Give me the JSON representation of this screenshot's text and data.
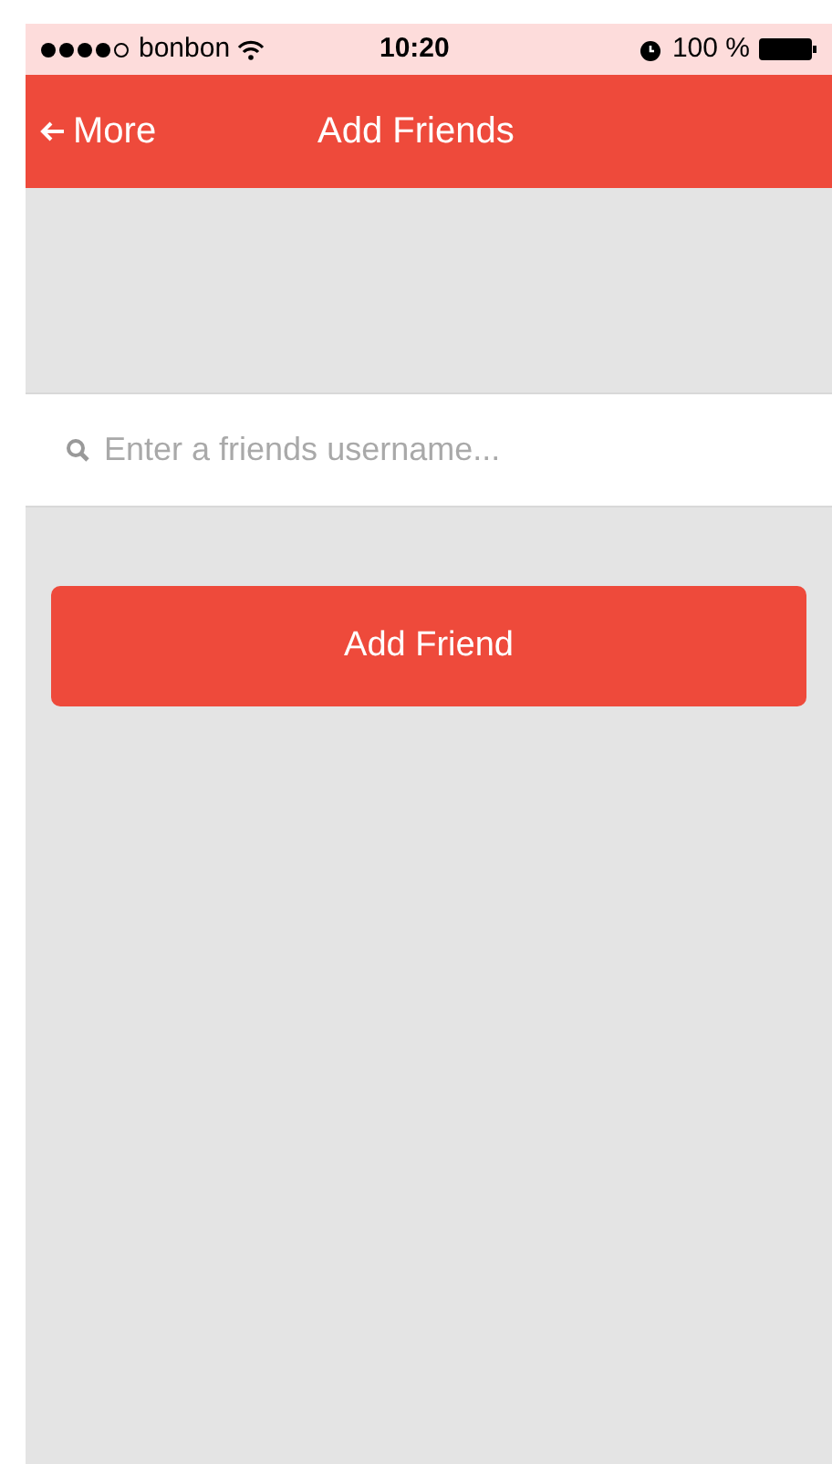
{
  "status_bar": {
    "carrier": "bonbon",
    "time": "10:20",
    "battery": "100 %"
  },
  "nav_bar": {
    "back": "More",
    "title": "Add Friends"
  },
  "search": {
    "placeholder": "Enter a friends username..."
  },
  "button": "Add Friend"
}
